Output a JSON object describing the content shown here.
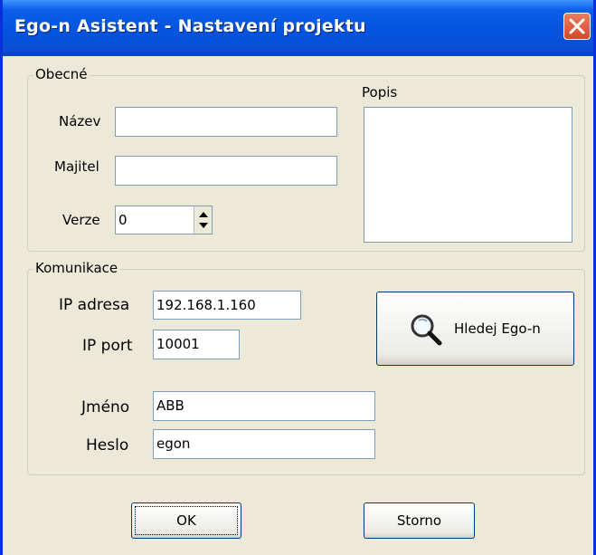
{
  "window": {
    "title": "Ego-n Asistent - Nastavení projektu"
  },
  "general": {
    "legend": "Obecné",
    "name_label": "Název",
    "name_value": "",
    "owner_label": "Majitel",
    "owner_value": "",
    "version_label": "Verze",
    "version_value": "0",
    "description_label": "Popis",
    "description_value": ""
  },
  "communication": {
    "legend": "Komunikace",
    "ip_label": "IP adresa",
    "ip_value": "192.168.1.160",
    "port_label": "IP port",
    "port_value": "10001",
    "user_label": "Jméno",
    "user_value": "ABB",
    "password_label": "Heslo",
    "password_value": "egon",
    "search_button": "Hledej Ego-n"
  },
  "buttons": {
    "ok": "OK",
    "cancel": "Storno"
  },
  "icons": {
    "close": "close-icon",
    "search": "magnifier-icon",
    "spin": "spin-arrows-icon"
  },
  "colors": {
    "titlebar": "#0a5fe8",
    "close_button": "#d4482a",
    "dialog_bg": "#ece9d8"
  }
}
